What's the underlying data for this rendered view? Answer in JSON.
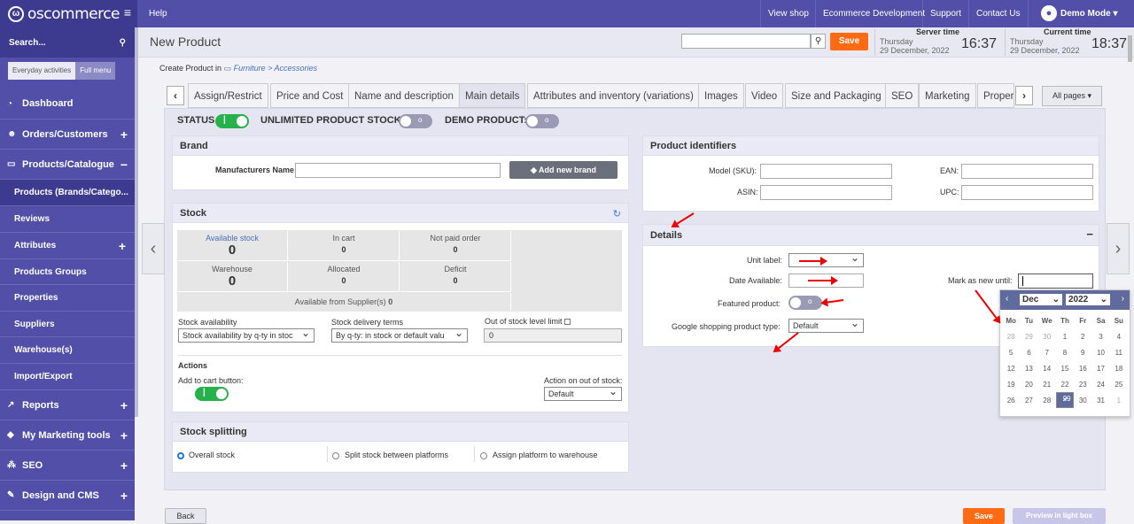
{
  "topbar": {
    "logo": "oscommerce",
    "help": "Help",
    "links": [
      "View shop",
      "Ecommerce Development",
      "Support",
      "Contact Us"
    ],
    "user": "Demo Mode"
  },
  "sidebar": {
    "search": "Search...",
    "mode_a": "Everyday activities",
    "mode_b": "Full menu",
    "items": [
      {
        "label": "Dashboard",
        "icon": "dashboard-icon"
      },
      {
        "label": "Orders/Customers",
        "icon": "users-icon"
      },
      {
        "label": "Products/Catalogue",
        "icon": "folder-icon"
      }
    ],
    "sub": [
      "Products (Brands/Catego...",
      "Reviews",
      "Attributes",
      "Products Groups",
      "Properties",
      "Suppliers",
      "Warehouse(s)",
      "Import/Export"
    ],
    "items2": [
      {
        "label": "Reports"
      },
      {
        "label": "My Marketing tools"
      },
      {
        "label": "SEO"
      },
      {
        "label": "Design and CMS"
      }
    ]
  },
  "header": {
    "title": "New Product",
    "save": "Save",
    "server_label": "Server time",
    "server_day": "Thursday",
    "server_date": "29 December, 2022",
    "server_time": "16:37",
    "current_label": "Current time",
    "current_day": "Thursday",
    "current_date": "29 December, 2022",
    "current_time": "18:37"
  },
  "breadcrumb": {
    "prefix": "Create Product in",
    "path": "Furniture > Accessories"
  },
  "tabs": [
    "Assign/Restrict",
    "Price and Cost",
    "Name and description",
    "Main details",
    "Attributes and inventory (variations)",
    "Images",
    "Video",
    "Size and Packaging",
    "SEO",
    "Marketing",
    "Proper"
  ],
  "all_pages": "All pages",
  "status": {
    "status": "STATUS",
    "unlimited": "UNLIMITED PRODUCT STOCK:",
    "demo": "DEMO PRODUCT:"
  },
  "brand": {
    "title": "Brand",
    "manufacturer_label": "Manufacturers Name",
    "add_brand": "Add new brand"
  },
  "stock": {
    "title": "Stock",
    "boxes": [
      {
        "label": "Available stock",
        "value": "0"
      },
      {
        "label": "In cart",
        "value": "0"
      },
      {
        "label": "Not paid order",
        "value": "0"
      },
      {
        "label": "Warehouse",
        "value": "0"
      },
      {
        "label": "Allocated",
        "value": "0"
      },
      {
        "label": "Deficit",
        "value": "0"
      }
    ],
    "supplier": "Available from Supplier(s)",
    "supplier_val": "0",
    "availability_label": "Stock availability",
    "availability_val": "Stock availability by q-ty in stoc",
    "delivery_label": "Stock delivery terms",
    "delivery_val": "By q-ty: in stock or default valu",
    "oos_label": "Out of stock level limit",
    "oos_val": "0",
    "actions": "Actions",
    "add_cart": "Add to cart button:",
    "oos_action": "Action on out of stock:",
    "oos_action_val": "Default"
  },
  "splitting": {
    "title": "Stock splitting",
    "options": [
      "Overall stock",
      "Split stock between platforms",
      "Assign platform to warehouse"
    ]
  },
  "identifiers": {
    "title": "Product identifiers",
    "sku": "Model (SKU):",
    "ean": "EAN:",
    "asin": "ASIN:",
    "upc": "UPC:"
  },
  "details": {
    "title": "Details",
    "unit": "Unit label:",
    "date": "Date Available:",
    "featured": "Featured product:",
    "google": "Google shopping product type:",
    "google_val": "Default",
    "mark_new": "Mark as new until:"
  },
  "calendar": {
    "month": "Dec",
    "year": "2022",
    "days": [
      "Mo",
      "Tu",
      "We",
      "Th",
      "Fr",
      "Sa",
      "Su"
    ],
    "weeks": [
      [
        "28",
        "29",
        "30",
        "1",
        "2",
        "3",
        "4"
      ],
      [
        "5",
        "6",
        "7",
        "8",
        "9",
        "10",
        "11"
      ],
      [
        "12",
        "13",
        "14",
        "15",
        "16",
        "17",
        "18"
      ],
      [
        "19",
        "20",
        "21",
        "22",
        "23",
        "24",
        "25"
      ],
      [
        "26",
        "27",
        "28",
        "29",
        "30",
        "31",
        "1"
      ]
    ]
  },
  "footer": {
    "back": "Back",
    "save": "Save",
    "preview": "Preview in light box"
  },
  "colors": {
    "accent": "#514fa8",
    "orange": "#ff6a13",
    "green": "#27b14a"
  }
}
